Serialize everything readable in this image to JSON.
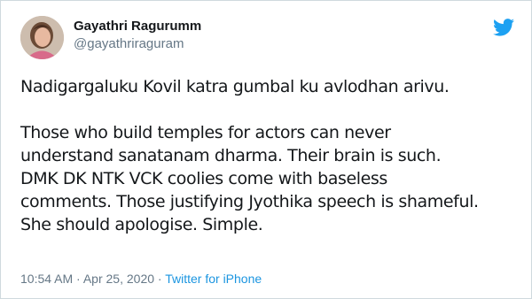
{
  "author": {
    "name": "Gayathri Ragurumm",
    "handle": "@gayathriraguram"
  },
  "tweet": {
    "line1": "Nadigargaluku Kovil katra gumbal ku avlodhan arivu.",
    "line2": "Those who build temples for actors can never",
    "line3": "understand sanatanam dharma. Their brain is such.",
    "line4": "DMK DK NTK VCK coolies come with baseless",
    "line5": "comments. Those justifying Jyothika speech is shameful.",
    "line6": "She should apologise. Simple."
  },
  "meta": {
    "time": "10:54 AM",
    "separator1": "·",
    "date": "Apr 25, 2020",
    "separator2": "·",
    "source": "Twitter for iPhone"
  },
  "colors": {
    "twitter_blue": "#1da1f2",
    "link": "#1b95e0",
    "secondary_text": "#657786",
    "primary_text": "#14171a"
  },
  "icons": {
    "logo": "twitter-bird-icon"
  }
}
